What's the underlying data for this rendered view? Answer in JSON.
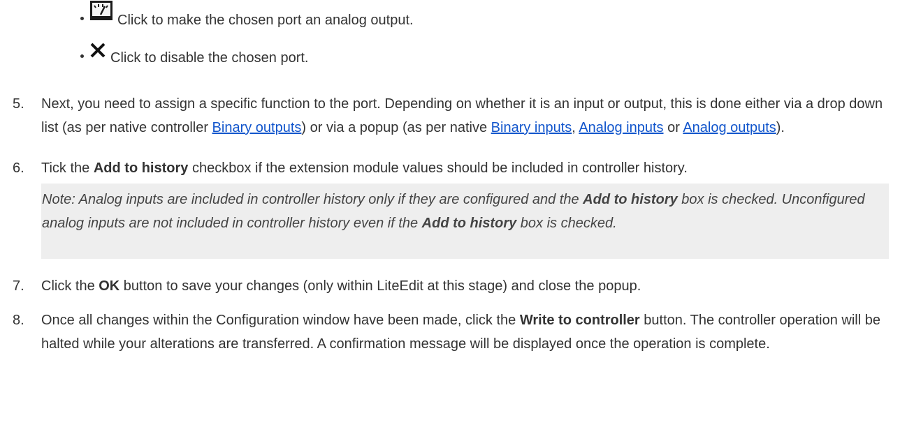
{
  "bullets": [
    {
      "icon": "analog-output-gauge-icon",
      "text": "Click to make the chosen port an analog output."
    },
    {
      "icon": "disable-x-icon",
      "text": "Click to disable the chosen port."
    }
  ],
  "step5": {
    "num": "5.",
    "text1": "Next, you need to assign a specific function to the port. Depending on whether it is an input or output, this is done either via a drop down list (as per native controller ",
    "link1": "Binary outputs",
    "text2": ") or via a popup (as per native ",
    "link2": "Binary inputs",
    "text3": ", ",
    "link3": "Analog inputs",
    "text4": " or ",
    "link4": "Analog outputs",
    "text5": ")."
  },
  "step6": {
    "num": "6.",
    "text1": "Tick the ",
    "bold1": "Add to history",
    "text2": " checkbox if the extension module values should be included in controller history."
  },
  "note": {
    "text1": "Note: Analog inputs are included in controller history only if they are configured and the ",
    "bold1": "Add to history",
    "text2": " box is checked. Unconfigured analog inputs are not included in controller history even if the ",
    "bold2": "Add to history",
    "text3": " box is checked."
  },
  "step7": {
    "num": "7.",
    "text1": "Click the ",
    "bold1": "OK",
    "text2": " button to save your changes (only within LiteEdit at this stage) and close the popup."
  },
  "step8": {
    "num": "8.",
    "text1": "Once all changes within the Configuration window have been made, click the ",
    "bold1": "Write to controller",
    "text2": " button. The controller operation will be halted while your alterations are transferred. A confirmation message will be displayed once the operation is complete."
  },
  "colors": {
    "link": "#1155cc",
    "note_bg": "#eeeeee",
    "text": "#333333"
  }
}
